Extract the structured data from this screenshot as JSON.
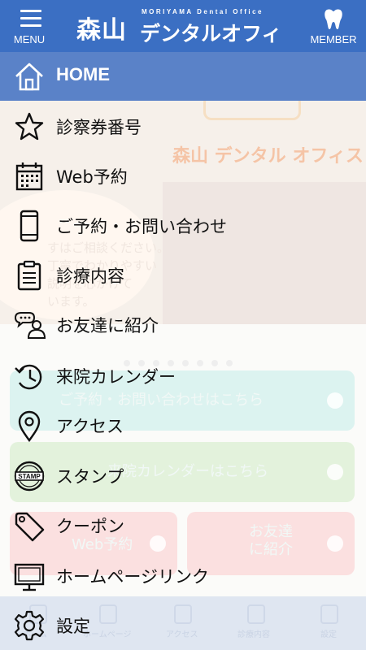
{
  "header": {
    "menu_label": "MENU",
    "member_label": "MEMBER",
    "logo_kanji": "森山",
    "logo_kana": "デンタルオフィス",
    "logo_sub": "MORIYAMA Dental Office"
  },
  "drawer": {
    "items": [
      {
        "label": "HOME",
        "icon": "home-icon"
      },
      {
        "label": "診察券番号",
        "icon": "star-icon"
      },
      {
        "label": "Web予約",
        "icon": "calendar-icon"
      },
      {
        "label": "ご予約・お問い合わせ",
        "icon": "phone-icon"
      },
      {
        "label": "診療内容",
        "icon": "clipboard-icon"
      },
      {
        "label": "お友達に紹介",
        "icon": "chat-person-icon"
      },
      {
        "label": "来院カレンダー",
        "icon": "history-icon"
      },
      {
        "label": "アクセス",
        "icon": "map-pin-icon"
      },
      {
        "label": "スタンプ",
        "icon": "stamp-icon"
      },
      {
        "label": "クーポン",
        "icon": "tag-icon"
      },
      {
        "label": "ホームページリンク",
        "icon": "monitor-icon"
      },
      {
        "label": "設定",
        "icon": "gear-icon"
      }
    ]
  },
  "background": {
    "hero_logo": "森山 デンタル オフィス",
    "bubble_text": [
      "すはご相談ください。",
      "丁寧でわかりやすい",
      "説明を心がけて",
      "います。"
    ],
    "card_contact": "ご予約・お問い合わせはこちら",
    "card_calendar": "来院カレンダーはこちら",
    "card_web": "Web予約",
    "card_friend_1": "お友達",
    "card_friend_2": "に紹介",
    "tabs": [
      "ホーム",
      "ホームページ",
      "アクセス",
      "診療内容",
      "設定"
    ]
  },
  "colors": {
    "header_bg": "#3b6fc3",
    "home_highlight": "#5a82c8"
  }
}
